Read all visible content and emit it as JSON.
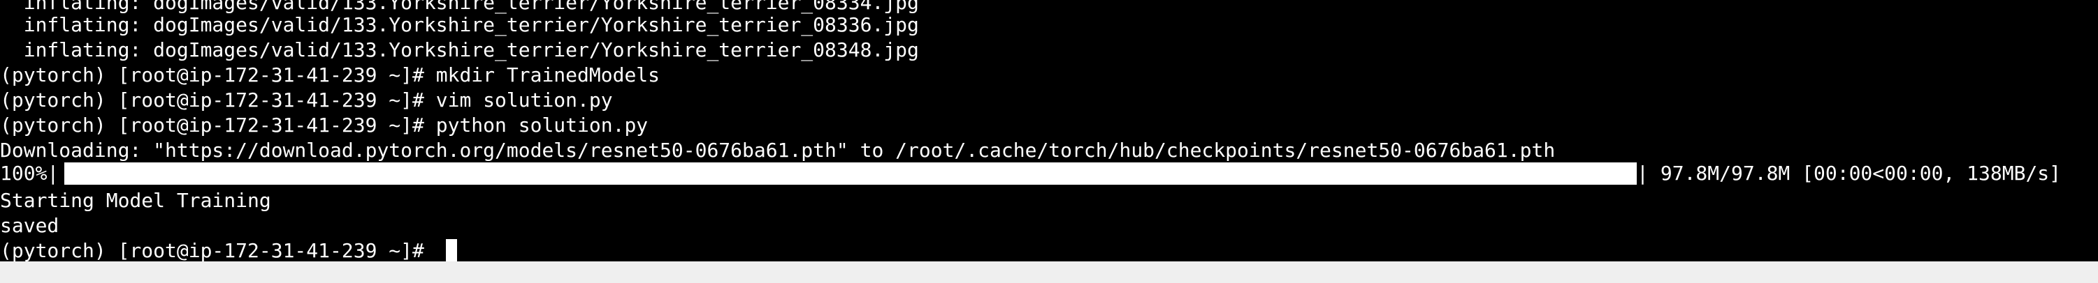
{
  "colors": {
    "terminal_bg": "#000000",
    "terminal_fg": "#ffffff",
    "bottom_strip": "#efefef"
  },
  "terminal": {
    "lines": [
      "  inflating: dogImages/valid/133.Yorkshire_terrier/Yorkshire_terrier_08334.jpg",
      "  inflating: dogImages/valid/133.Yorkshire_terrier/Yorkshire_terrier_08336.jpg",
      "  inflating: dogImages/valid/133.Yorkshire_terrier/Yorkshire_terrier_08348.jpg",
      "(pytorch) [root@ip-172-31-41-239 ~]# mkdir TrainedModels",
      "(pytorch) [root@ip-172-31-41-239 ~]# vim solution.py",
      "(pytorch) [root@ip-172-31-41-239 ~]# python solution.py",
      "Downloading: \"https://download.pytorch.org/models/resnet50-0676ba61.pth\" to /root/.cache/torch/hub/checkpoints/resnet50-0676ba61.pth"
    ],
    "progress": {
      "percent_label": "100%|",
      "fraction": 1.0,
      "end_bar": "|",
      "stats": " 97.8M/97.8M [00:00<00:00, 138MB/s]"
    },
    "after_lines": [
      "Starting Model Training",
      "saved"
    ],
    "prompt": "(pytorch) [root@ip-172-31-41-239 ~]# "
  }
}
